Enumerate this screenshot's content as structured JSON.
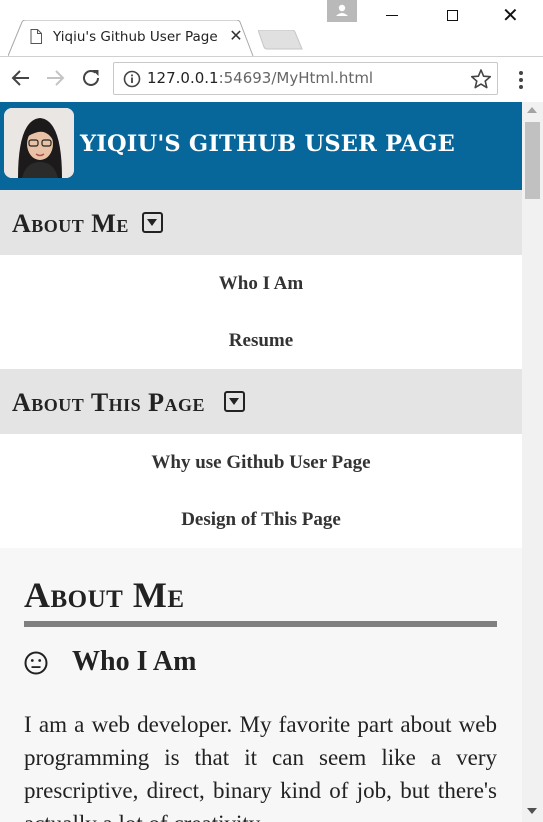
{
  "browser": {
    "tab_title": "Yiqiu's Github User Page",
    "url_host": "127.0.0.1",
    "url_rest": ":54693/MyHtml.html"
  },
  "header": {
    "site_title": "YIQIU'S GITHUB USER PAGE"
  },
  "nav": {
    "sections": [
      {
        "label": "About Me",
        "links": [
          "Who I Am",
          "Resume"
        ]
      },
      {
        "label": "About This Page",
        "links": [
          "Why use Github User Page",
          "Design of This Page"
        ]
      }
    ]
  },
  "content": {
    "heading": "About Me",
    "subheading": "Who I Am",
    "paragraph": "I am a web developer. My favorite part about web programming is that it can seem like a very prescriptive, direct, binary kind of job, but there's actually a lot of creativity"
  },
  "colors": {
    "header_bg": "#07669a",
    "nav_section_bg": "#e4e4e4",
    "rule": "#808080"
  },
  "icons": {
    "tab": "document-icon",
    "back": "back-arrow-icon",
    "forward": "forward-arrow-icon",
    "reload": "reload-icon",
    "info": "info-icon",
    "star": "star-icon",
    "menu": "kebab-menu-icon",
    "section_toggle": "caret-square-down-icon",
    "subheading": "neutral-face-icon"
  }
}
